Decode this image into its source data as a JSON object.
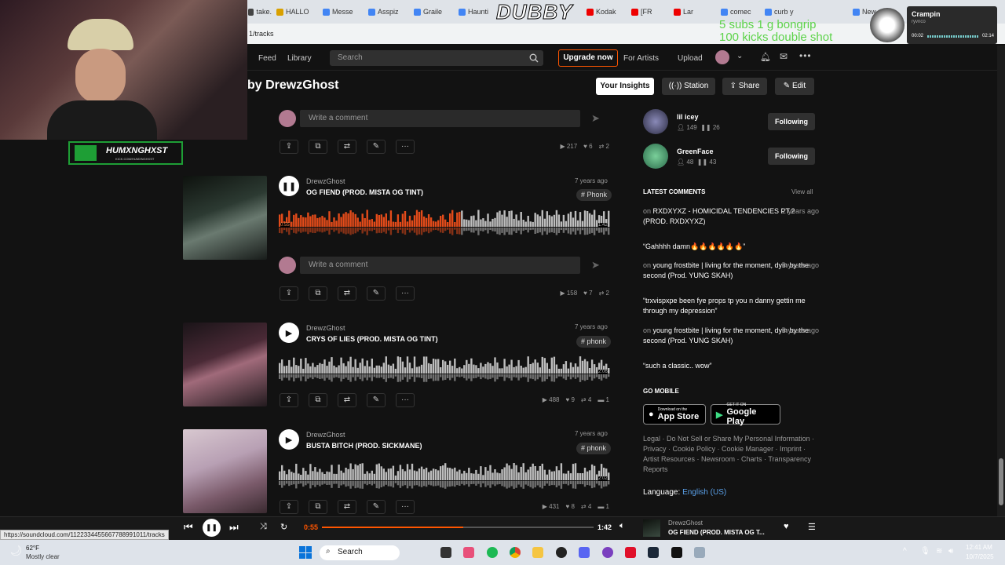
{
  "browser": {
    "tabs": [
      {
        "label": "take.",
        "color": "#444"
      },
      {
        "label": "HALLO",
        "color": "#d9a000"
      },
      {
        "label": "Messe",
        "color": "#4285f4"
      },
      {
        "label": "Asspiz",
        "color": "#4285f4"
      },
      {
        "label": "Graile",
        "color": "#4285f4"
      },
      {
        "label": "Haunti",
        "color": "#4285f4"
      },
      {
        "label": "Kodak",
        "color": "#e00"
      },
      {
        "label": "[FR",
        "color": "#e00"
      },
      {
        "label": "Lar",
        "color": "#e00"
      },
      {
        "label": "comec",
        "color": "#4285f4"
      },
      {
        "label": "curb y",
        "color": "#4285f4"
      },
      {
        "label": "New",
        "color": "#4285f4"
      }
    ],
    "url": "1/tracks"
  },
  "header": {
    "feed": "Feed",
    "library": "Library",
    "search_placeholder": "Search",
    "upgrade": "Upgrade now",
    "for_artists": "For Artists",
    "upload": "Upload"
  },
  "page": {
    "title": "by DrewzGhost",
    "your_insights": "Your Insights",
    "station": "Station",
    "share": "Share",
    "edit": "Edit"
  },
  "comment_placeholder": "Write a comment",
  "tracks": [
    {
      "stats": {
        "plays": "217",
        "likes": "6",
        "reposts": "2"
      }
    },
    {
      "artist": "DrewzGhost",
      "title": "OG FIEND (PROD. MISTA OG TINT)",
      "date": "7 years ago",
      "tag": "# Phonk",
      "time_start": "0:55",
      "time_end": "1:42",
      "progress": 0.55,
      "playing": true,
      "stats": {
        "plays": "158",
        "likes": "7",
        "reposts": "2"
      }
    },
    {
      "artist": "DrewzGhost",
      "title": "CRYS OF LIES (PROD. MISTA OG TINT)",
      "date": "7 years ago",
      "tag": "# phonk",
      "time_end": "2:06",
      "progress": 0,
      "playing": false,
      "stats": {
        "plays": "488",
        "likes": "9",
        "reposts": "4",
        "comments": "1"
      }
    },
    {
      "artist": "DrewzGhost",
      "title": "BUSTA BITCH (PROD. SICKMANE)",
      "date": "7 years ago",
      "tag": "# phonk",
      "time_end": "2:02",
      "progress": 0,
      "playing": false,
      "stats": {
        "plays": "431",
        "likes": "8",
        "reposts": "4",
        "comments": "1"
      }
    }
  ],
  "sidebar": {
    "following": [
      {
        "name": "lil icey",
        "followers": "149",
        "tracks": "26",
        "button": "Following"
      },
      {
        "name": "GreenFace",
        "followers": "48",
        "tracks": "43",
        "button": "Following"
      }
    ],
    "latest_comments_heading": "LATEST COMMENTS",
    "view_all": "View all",
    "comments": [
      {
        "on": "on",
        "track": "RXDXYXZ - HOMICIDAL TENDENCIES PT.2 (PROD. RXDXYXZ)",
        "ago": "2 years ago",
        "text": "“Gahhhh damn🔥🔥🔥🔥🔥🔥”"
      },
      {
        "on": "on",
        "track": "young frostbite | living for the moment, dyin by the second (Prod. YUNG SKAH)",
        "ago": "3 years ago",
        "text": "“trxvispxpe been fye props tp you n danny gettin me through my depression”"
      },
      {
        "on": "on",
        "track": "young frostbite | living for the moment, dyin by the second (Prod. YUNG SKAH)",
        "ago": "3 years ago",
        "text": "“such a classic.. wow”"
      }
    ],
    "go_mobile": "GO MOBILE",
    "app_store_small": "Download on the",
    "app_store": "App Store",
    "google_small": "GET IT ON",
    "google_play": "Google Play",
    "legal": "Legal · Do Not Sell or Share My Personal Information · Privacy · Cookie Policy · Cookie Manager · Imprint · Artist Resources · Newsroom · Charts · Transparency Reports",
    "language_label": "Language:",
    "language": "English (US)"
  },
  "player": {
    "time_current": "0:55",
    "time_total": "1:42",
    "progress": 0.52,
    "artist": "DrewzGhost",
    "title": "OG FIEND (PROD. MISTA OG T..."
  },
  "status_url": "https://soundcloud.com/1122334455667788991011/tracks",
  "taskbar": {
    "temp": "62°F",
    "weather": "Mostly clear",
    "search": "Search",
    "time": "12:41 AM",
    "date": "10/7/2025"
  },
  "overlay": {
    "dubby": "DUBBY",
    "goal_line1": "5 subs 1 g bongrip",
    "goal_line2": "100 kicks double shot",
    "streamer_tag": "HUMXNGHXST",
    "streamer_sub": "KICK.COM/HUMXNGHXST",
    "spotify_title": "Crampin",
    "spotify_artist": "ryvnco",
    "spotify_pos": "00:02",
    "spotify_len": "02:14"
  },
  "colors": {
    "accent": "#ff5500",
    "bg": "#121212",
    "wave_played": "#e34b1a",
    "wave_unplayed": "#bdbdbd"
  }
}
